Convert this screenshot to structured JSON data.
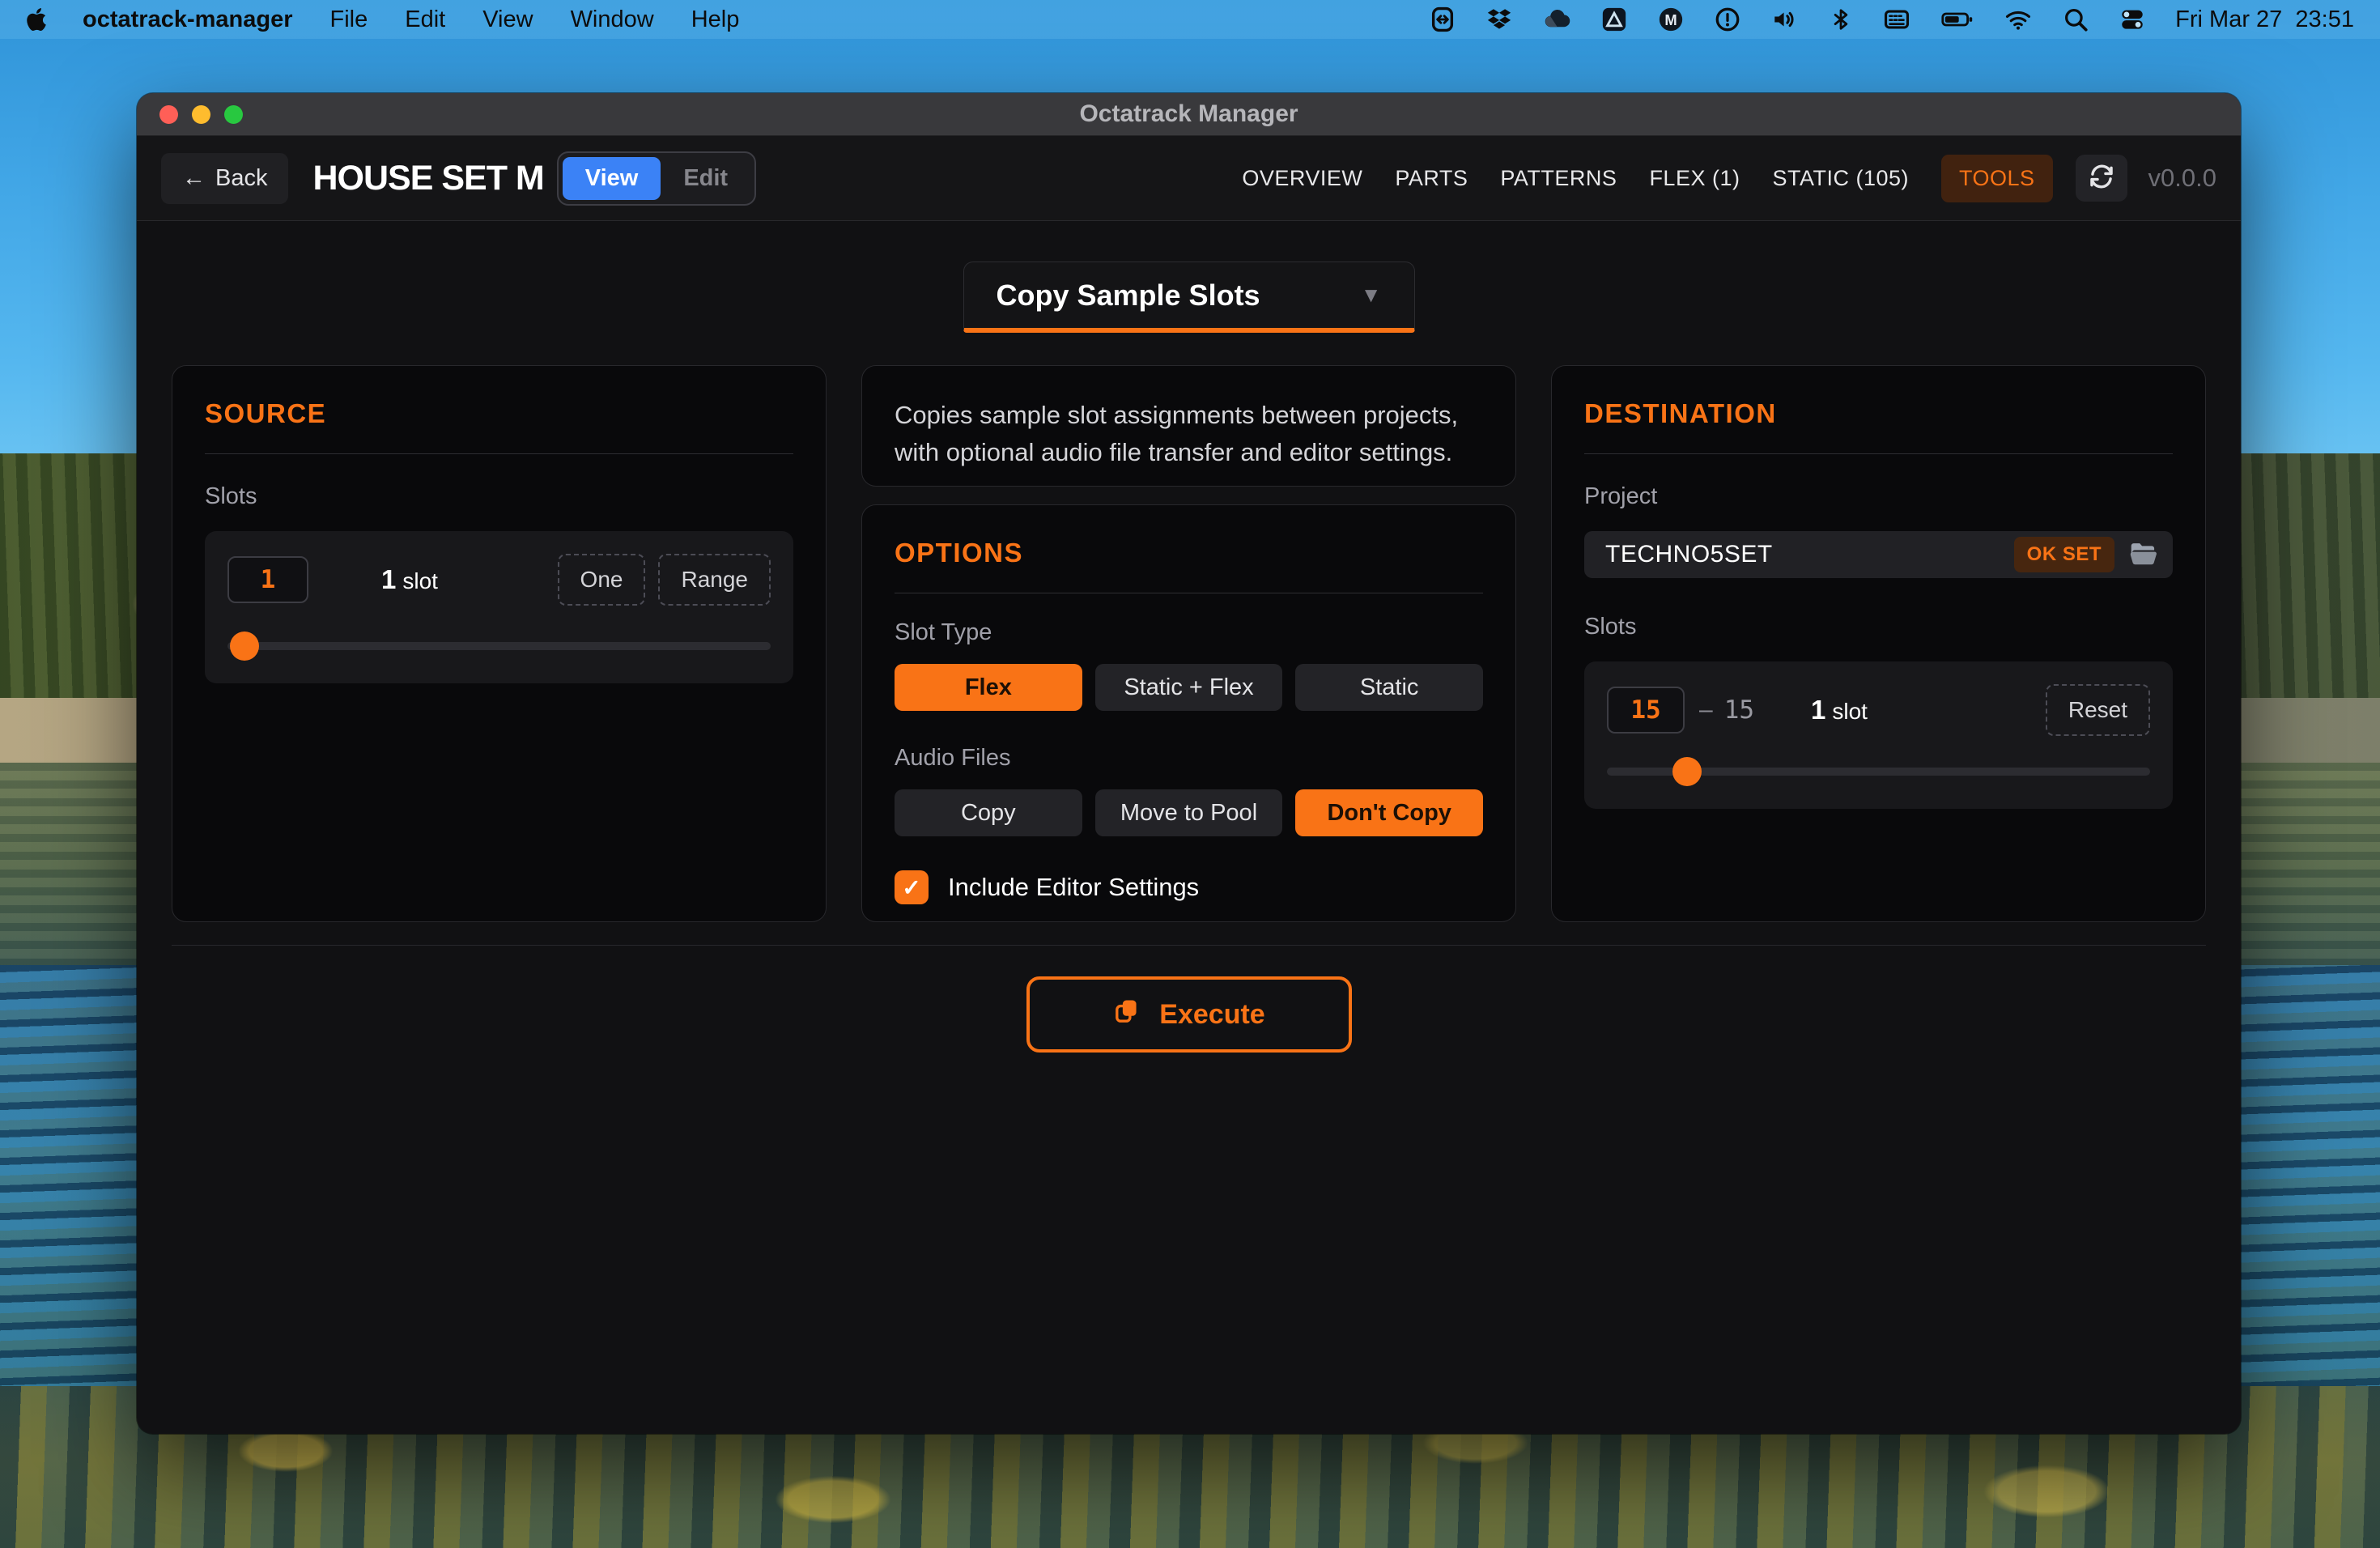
{
  "menubar": {
    "app_name": "octatrack-manager",
    "menus": [
      "File",
      "Edit",
      "View",
      "Window",
      "Help"
    ],
    "status_icons": [
      "display-mirroring-icon",
      "dropbox-icon",
      "cloud-app-icon",
      "triangle-app-icon",
      "m-app-icon",
      "time-machine-icon",
      "volume-icon",
      "bluetooth-icon",
      "input-source-icon",
      "battery-icon",
      "wifi-icon",
      "spotlight-icon",
      "control-center-icon"
    ],
    "clock": "Fri Mar 27  23:51"
  },
  "window": {
    "title": "Octatrack Manager",
    "header": {
      "back_label": "Back",
      "set_title": "HOUSE SET M",
      "mode_view": "View",
      "mode_edit": "Edit",
      "nav": [
        "OVERVIEW",
        "PARTS",
        "PATTERNS",
        "FLEX (1)",
        "STATIC (105)",
        "TOOLS"
      ],
      "version": "v0.0.0"
    },
    "tool_selector": {
      "value": "Copy Sample Slots"
    },
    "source": {
      "heading": "SOURCE",
      "slots_label": "Slots",
      "slot_value": "1",
      "count_num": "1",
      "count_unit": "slot",
      "one_label": "One",
      "range_label": "Range",
      "slider_pos_pct": 1
    },
    "description": "Copies sample slot assignments between projects, with optional audio file transfer and editor settings.",
    "options": {
      "heading": "OPTIONS",
      "slot_type_label": "Slot Type",
      "slot_type_buttons": [
        "Flex",
        "Static + Flex",
        "Static"
      ],
      "slot_type_selected": "Flex",
      "audio_files_label": "Audio Files",
      "audio_files_buttons": [
        "Copy",
        "Move to Pool",
        "Don't Copy"
      ],
      "audio_files_selected": "Don't Copy",
      "include_editor_label": "Include Editor Settings",
      "include_editor_checked": true
    },
    "destination": {
      "heading": "DESTINATION",
      "project_label": "Project",
      "project_value": "TECHNO5SET",
      "project_status": "OK SET",
      "slots_label": "Slots",
      "slot_start": "15",
      "range_separator": "–",
      "slot_end": "15",
      "count_num": "1",
      "count_unit": "slot",
      "reset_label": "Reset",
      "slider_pos_pct": 12
    },
    "execute_label": "Execute"
  },
  "icons": {
    "back_arrow": "←",
    "caret_down": "▼",
    "check": "✓"
  },
  "colors": {
    "accent": "#f97316",
    "view_active_blue": "#3b82f6",
    "window_bg": "#111113",
    "panel_bg": "#09090b"
  }
}
